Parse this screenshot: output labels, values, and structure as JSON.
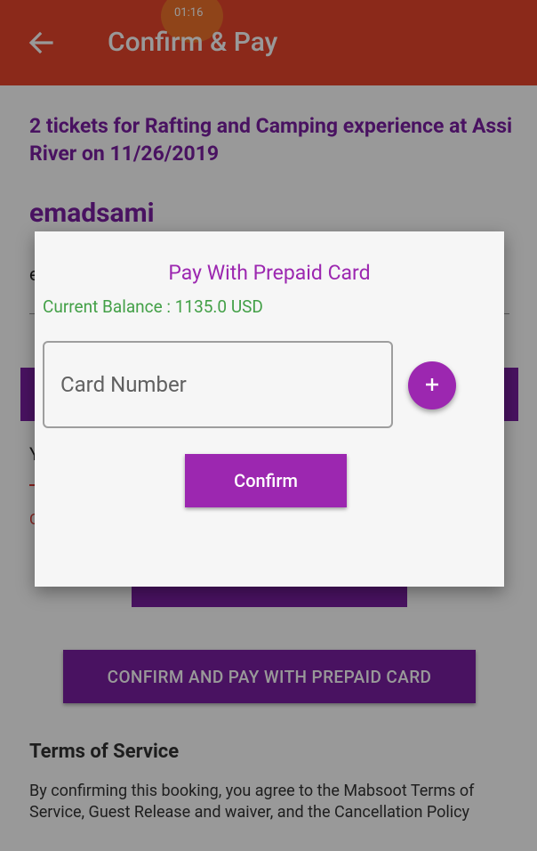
{
  "status_bar": {
    "time": "01:16"
  },
  "appbar": {
    "title": "Confirm & Pay",
    "back_icon": "arrow-left-icon",
    "color": "#e8452c"
  },
  "booking": {
    "summary": "2 tickets for Rafting and Camping experience at Assi River on 11/26/2019",
    "username": "emadsami",
    "email_partial": "e",
    "partial_text_1": "Y",
    "partial_text_2": "C"
  },
  "prepaid_button": {
    "label": "CONFIRM AND PAY WITH PREPAID CARD"
  },
  "terms": {
    "title": "Terms of Service",
    "text": "By confirming this booking, you agree to the Mabsoot Terms of Service, Guest Release and waiver, and the Cancellation Policy"
  },
  "dialog": {
    "title": "Pay With Prepaid Card",
    "balance": "Current Balance : 1135.0 USD",
    "card_field": {
      "value": "",
      "placeholder": "Card Number"
    },
    "add_icon": "plus-icon",
    "confirm_label": "Confirm"
  },
  "colors": {
    "primary": "#7b1fa2",
    "accent": "#9c27b0",
    "balance": "#43a047",
    "error": "#e53935"
  }
}
